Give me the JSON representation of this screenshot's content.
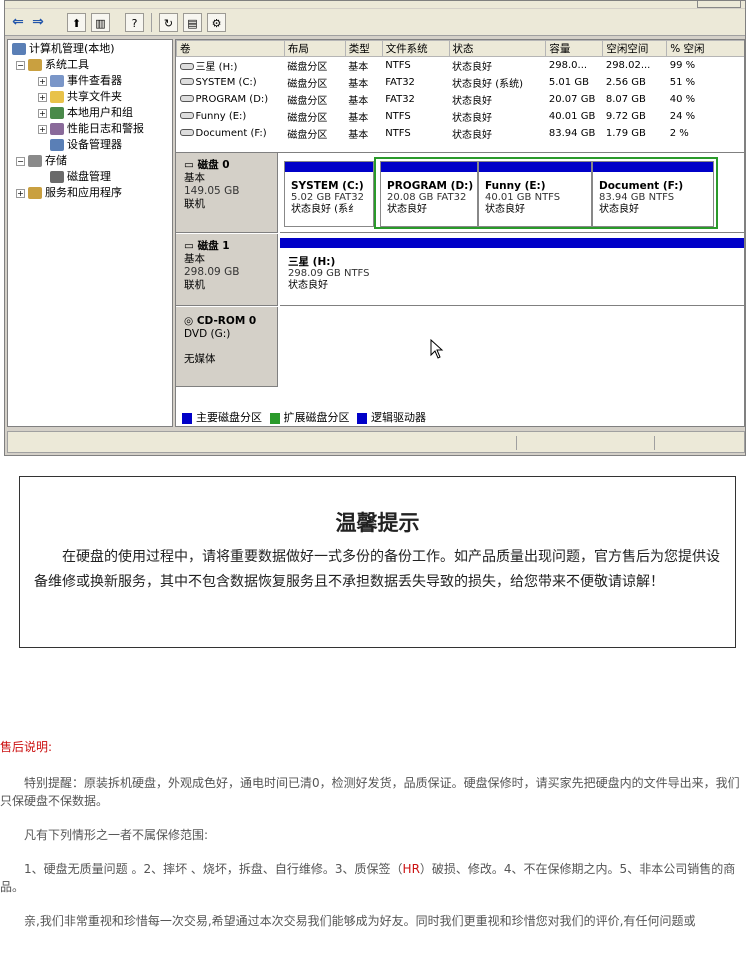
{
  "toolbar": {
    "back_icon": "arrow-left-icon",
    "forward_icon": "arrow-right-icon"
  },
  "tree": {
    "items": [
      {
        "label": "计算机管理(本地)",
        "icon": "computer-icon"
      },
      {
        "label": "系统工具",
        "icon": "tools-icon"
      },
      {
        "label": "事件查看器",
        "icon": "event-viewer-icon"
      },
      {
        "label": "共享文件夹",
        "icon": "folder-icon"
      },
      {
        "label": "本地用户和组",
        "icon": "users-icon"
      },
      {
        "label": "性能日志和警报",
        "icon": "performance-icon"
      },
      {
        "label": "设备管理器",
        "icon": "device-manager-icon"
      },
      {
        "label": "存储",
        "icon": "storage-icon"
      },
      {
        "label": "磁盘管理",
        "icon": "disk-management-icon"
      },
      {
        "label": "服务和应用程序",
        "icon": "services-icon"
      }
    ]
  },
  "volumes": {
    "headers": [
      "卷",
      "布局",
      "类型",
      "文件系统",
      "状态",
      "容量",
      "空闲空间",
      "% 空闲"
    ],
    "rows": [
      [
        "三星 (H:)",
        "磁盘分区",
        "基本",
        "NTFS",
        "状态良好",
        "298.0...",
        "298.02...",
        "99 %"
      ],
      [
        "SYSTEM (C:)",
        "磁盘分区",
        "基本",
        "FAT32",
        "状态良好 (系统)",
        "5.01 GB",
        "2.56 GB",
        "51 %"
      ],
      [
        "PROGRAM (D:)",
        "磁盘分区",
        "基本",
        "FAT32",
        "状态良好",
        "20.07 GB",
        "8.07 GB",
        "40 %"
      ],
      [
        "Funny (E:)",
        "磁盘分区",
        "基本",
        "NTFS",
        "状态良好",
        "40.01 GB",
        "9.72 GB",
        "24 %"
      ],
      [
        "Document (F:)",
        "磁盘分区",
        "基本",
        "NTFS",
        "状态良好",
        "83.94 GB",
        "1.79 GB",
        "2 %"
      ]
    ]
  },
  "disks": [
    {
      "name": "磁盘 0",
      "type": "基本",
      "size": "149.05 GB",
      "status": "联机",
      "partitions": [
        {
          "title": "SYSTEM (C:)",
          "info": "5.02 GB FAT32",
          "status": "状态良好 (系纟"
        },
        {
          "title": "PROGRAM (D:)",
          "info": "20.08 GB FAT32",
          "status": "状态良好"
        },
        {
          "title": "Funny (E:)",
          "info": "40.01 GB NTFS",
          "status": "状态良好"
        },
        {
          "title": "Document (F:)",
          "info": "83.94 GB NTFS",
          "status": "状态良好"
        }
      ]
    },
    {
      "name": "磁盘 1",
      "type": "基本",
      "size": "298.09 GB",
      "status": "联机",
      "partitions": [
        {
          "title": "三星 (H:)",
          "info": "298.09 GB NTFS",
          "status": "状态良好"
        }
      ]
    },
    {
      "name": "CD-ROM 0",
      "type": "DVD (G:)",
      "status": "无媒体"
    }
  ],
  "legend": [
    {
      "label": "主要磁盘分区",
      "color": "#0000c8"
    },
    {
      "label": "扩展磁盘分区",
      "color": "#2a9a2a"
    },
    {
      "label": "逻辑驱动器",
      "color": "#0000c8"
    }
  ],
  "notice": {
    "title": "温馨提示",
    "body": "在硬盘的使用过程中，请将重要数据做好一式多份的备份工作。如产品质量出现问题，官方售后为您提供设备维修或换新服务，其中不包含数据恢复服务且不承担数据丢失导致的损失，给您带来不便敬请谅解！"
  },
  "after_sales": {
    "title": "售后说明:",
    "p1": "特别提醒：原装拆机硬盘，外观成色好，通电时间已清0，检测好发货，品质保证。硬盘保修时，请买家先把硬盘内的文件导出来，我们只保硬盘不保数据。",
    "p2": "凡有下列情形之一者不属保修范围:",
    "p3_before": "1、硬盘无质量问题 。2、摔坏 、烧坏，拆盘、自行维修。3、质保签（",
    "p3_hr": "HR",
    "p3_after": "）破损、修改。4、不在保修期之内。5、非本公司销售的商品。",
    "p4": "亲,我们非常重视和珍惜每一次交易,希望通过本次交易我们能够成为好友。同时我们更重视和珍惜您对我们的评价,有任何问题或"
  }
}
